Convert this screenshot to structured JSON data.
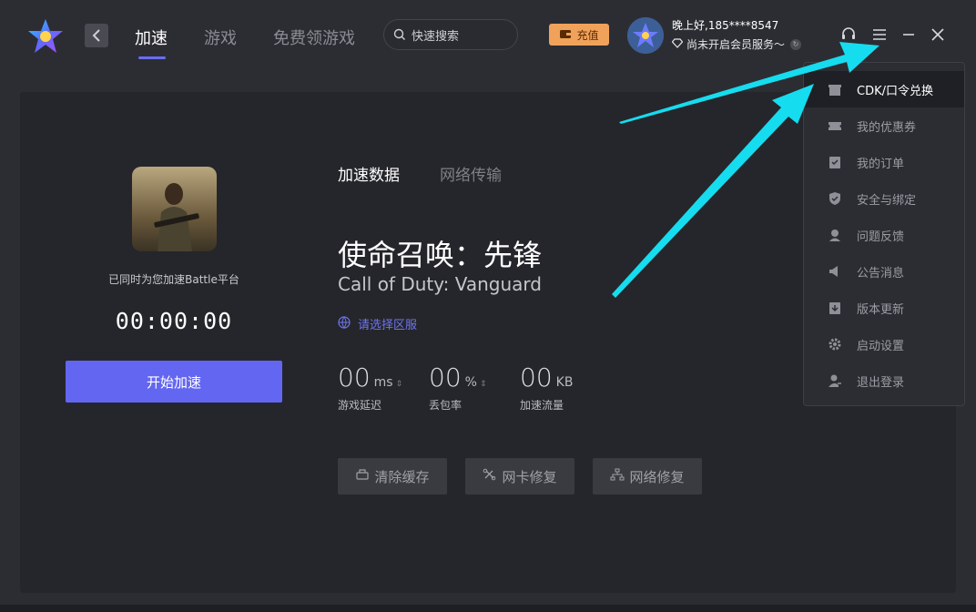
{
  "nav": {
    "back_icon": "chevron-left-icon",
    "tabs": [
      {
        "label": "加速",
        "active": true
      },
      {
        "label": "游戏",
        "active": false
      },
      {
        "label": "免费领游戏",
        "active": false
      }
    ]
  },
  "search": {
    "placeholder": "快速搜索",
    "icon": "search-icon"
  },
  "recharge": {
    "label": "充值",
    "icon": "wallet-icon"
  },
  "user": {
    "greeting": "晚上好,185****8547",
    "member_status": "尚未开启会员服务～",
    "member_icon": "diamond-icon",
    "refresh_icon": "refresh-icon"
  },
  "window_controls": [
    "support-icon",
    "menu-icon",
    "minimize-icon",
    "close-icon"
  ],
  "left_panel": {
    "platform_note": "已同时为您加速Battle平台",
    "timer": "00:00:00",
    "start_button": "开始加速"
  },
  "sub_tabs": [
    {
      "label": "加速数据",
      "active": true
    },
    {
      "label": "网络传输",
      "active": false
    }
  ],
  "game": {
    "title_cn": "使命召唤：先锋",
    "title_en": "Call of Duty: Vanguard",
    "region_label": "请选择区服"
  },
  "stats": [
    {
      "value": "00",
      "unit": "ms",
      "label": "游戏延迟",
      "has_arrows": true
    },
    {
      "value": "00",
      "unit": "%",
      "label": "丢包率",
      "has_arrows": true
    },
    {
      "value": "00",
      "unit": "KB",
      "label": "加速流量",
      "has_arrows": false
    }
  ],
  "tools": [
    {
      "label": "清除缓存",
      "icon": "broom-icon"
    },
    {
      "label": "网卡修复",
      "icon": "wrench-icon"
    },
    {
      "label": "网络修复",
      "icon": "network-icon"
    }
  ],
  "menu": {
    "items": [
      {
        "label": "CDK/口令兑换",
        "icon": "gift-icon",
        "highlight": true
      },
      {
        "label": "我的优惠券",
        "icon": "coupon-icon",
        "highlight": false
      },
      {
        "label": "我的订单",
        "icon": "order-icon",
        "highlight": false
      },
      {
        "label": "安全与绑定",
        "icon": "shield-icon",
        "highlight": false
      },
      {
        "label": "问题反馈",
        "icon": "feedback-icon",
        "highlight": false
      },
      {
        "label": "公告消息",
        "icon": "megaphone-icon",
        "highlight": false
      },
      {
        "label": "版本更新",
        "icon": "update-icon",
        "highlight": false
      },
      {
        "label": "启动设置",
        "icon": "gear-icon",
        "highlight": false
      },
      {
        "label": "退出登录",
        "icon": "logout-icon",
        "highlight": false
      }
    ]
  },
  "colors": {
    "accent": "#6366f1",
    "recharge": "#f0a25a",
    "annotation_arrow": "#16dcef",
    "background": "#2c2d33",
    "card": "#25262b"
  }
}
